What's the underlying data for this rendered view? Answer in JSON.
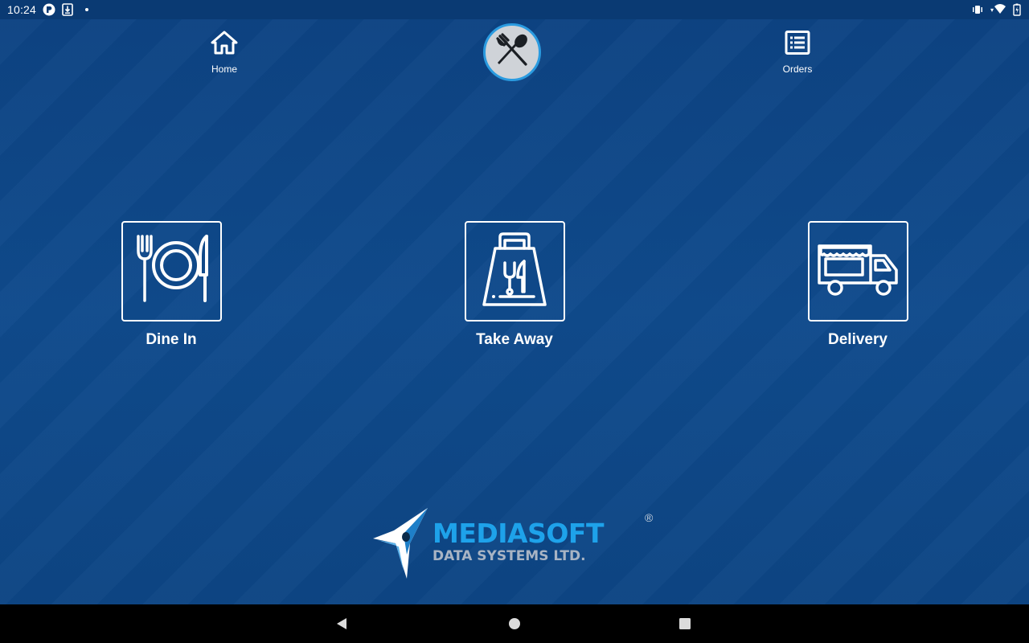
{
  "status_bar": {
    "time": "10:24",
    "icons": [
      "p-circle-icon",
      "download-icon",
      "dot-icon",
      "vibrate-icon",
      "wifi-icon",
      "battery-icon"
    ]
  },
  "top_nav": {
    "home_label": "Home",
    "orders_label": "Orders",
    "logo_icon": "fork-spoon-icon"
  },
  "services": [
    {
      "label": "Dine In",
      "icon": "plate-fork-knife-icon"
    },
    {
      "label": "Take Away",
      "icon": "takeaway-bag-icon"
    },
    {
      "label": "Delivery",
      "icon": "delivery-truck-icon"
    }
  ],
  "brand": {
    "name": "MEDIASOFT",
    "subtitle": "DATA SYSTEMS LTD.",
    "registered": "®"
  },
  "colors": {
    "background": "#0f4787",
    "status_bar": "#0a3a73",
    "brand_blue": "#1ea2ea",
    "brand_gray": "#a8b4c4",
    "logo_ring": "#2a9be0"
  },
  "system_nav": {
    "icons": [
      "back-triangle-icon",
      "home-circle-icon",
      "recents-square-icon"
    ]
  }
}
